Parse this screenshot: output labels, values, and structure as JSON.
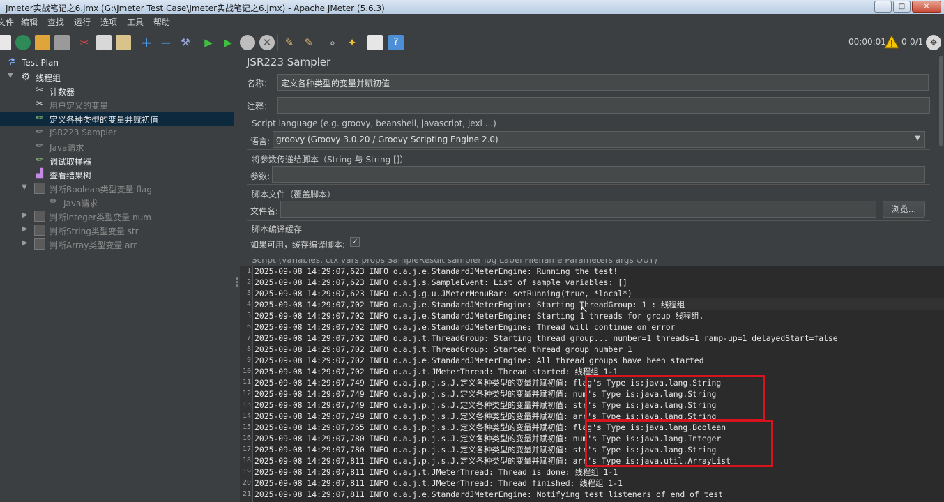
{
  "window": {
    "title": "Jmeter实战笔记之6.jmx (G:\\Jmeter Test Case\\Jmeter实战笔记之6.jmx) - Apache JMeter (5.6.3)",
    "min_label": "─",
    "max_label": "□",
    "close_label": "✕"
  },
  "menu": [
    "文件",
    "编辑",
    "查找",
    "运行",
    "选项",
    "工具",
    "帮助"
  ],
  "toolbar": {
    "timer": "00:00:01",
    "warnings": "0",
    "threads": "0/1"
  },
  "tree": {
    "items": [
      {
        "label": "Test Plan",
        "icon": "test-plan-icon"
      },
      {
        "label": "线程组",
        "icon": "gear-icon"
      },
      {
        "label": "计数器",
        "icon": "scissors-icon"
      },
      {
        "label": "用户定义的变量",
        "icon": "scissors-icon"
      },
      {
        "label": "定义各种类型的变量并赋初值",
        "icon": "pipette-icon"
      },
      {
        "label": "JSR223 Sampler",
        "icon": "pipette-icon"
      },
      {
        "label": "Java请求",
        "icon": "pipette-icon"
      },
      {
        "label": "调试取样器",
        "icon": "pipette-icon"
      },
      {
        "label": "查看结果树",
        "icon": "chart-icon"
      },
      {
        "label": "判断Boolean类型变量 flag",
        "icon": "controller-icon"
      },
      {
        "label": "Java请求",
        "icon": "pipette-icon"
      },
      {
        "label": "判断Integer类型变量 num",
        "icon": "controller-icon"
      },
      {
        "label": "判断String类型变量 str",
        "icon": "controller-icon"
      },
      {
        "label": "判断Array类型变量 arr",
        "icon": "controller-icon"
      }
    ]
  },
  "panel": {
    "title": "JSR223 Sampler",
    "name_label": "名称：",
    "name_value": "定义各种类型的变量并赋初值",
    "comment_label": "注释：",
    "comment_value": "",
    "script_language_group": "Script language (e.g. groovy, beanshell, javascript, jexl ...)",
    "language_label": "语言:",
    "language_value": "groovy     (Groovy 3.0.20 / Groovy Scripting Engine 2.0)",
    "params_group": "将参数传递给脚本（String 与 String []）",
    "params_label": "参数:",
    "params_value": "",
    "file_group": "脚本文件（覆盖脚本）",
    "filename_label": "文件名:",
    "filename_value": "",
    "browse_label": "浏览...",
    "cache_group": "脚本编译缓存",
    "cache_label": "如果可用，缓存编译脚本:",
    "cache_checked": "✓",
    "script_group_cut": "Script (variables: ctx vars props SampleResult sampler log Label Filename Parameters args OUT)"
  },
  "log": {
    "lines": [
      "2025-09-08 14:29:07,623 INFO o.a.j.e.StandardJMeterEngine: Running the test!",
      "2025-09-08 14:29:07,623 INFO o.a.j.s.SampleEvent: List of sample_variables: []",
      "2025-09-08 14:29:07,623 INFO o.a.j.g.u.JMeterMenuBar: setRunning(true, *local*)",
      "2025-09-08 14:29:07,702 INFO o.a.j.e.StandardJMeterEngine: Starting ThreadGroup: 1 : 线程组",
      "2025-09-08 14:29:07,702 INFO o.a.j.e.StandardJMeterEngine: Starting 1 threads for group 线程组.",
      "2025-09-08 14:29:07,702 INFO o.a.j.e.StandardJMeterEngine: Thread will continue on error",
      "2025-09-08 14:29:07,702 INFO o.a.j.t.ThreadGroup: Starting thread group... number=1 threads=1 ramp-up=1 delayedStart=false",
      "2025-09-08 14:29:07,702 INFO o.a.j.t.ThreadGroup: Started thread group number 1",
      "2025-09-08 14:29:07,702 INFO o.a.j.e.StandardJMeterEngine: All thread groups have been started",
      "2025-09-08 14:29:07,702 INFO o.a.j.t.JMeterThread: Thread started: 线程组 1-1",
      "2025-09-08 14:29:07,749 INFO o.a.j.p.j.s.J.定义各种类型的变量并赋初值: flag's Type is:java.lang.String",
      "2025-09-08 14:29:07,749 INFO o.a.j.p.j.s.J.定义各种类型的变量并赋初值: num's Type is:java.lang.String",
      "2025-09-08 14:29:07,749 INFO o.a.j.p.j.s.J.定义各种类型的变量并赋初值: str's Type is:java.lang.String",
      "2025-09-08 14:29:07,749 INFO o.a.j.p.j.s.J.定义各种类型的变量并赋初值: arr's Type is:java.lang.String",
      "2025-09-08 14:29:07,765 INFO o.a.j.p.j.s.J.定义各种类型的变量并赋初值: flag's Type is:java.lang.Boolean",
      "2025-09-08 14:29:07,780 INFO o.a.j.p.j.s.J.定义各种类型的变量并赋初值: num's Type is:java.lang.Integer",
      "2025-09-08 14:29:07,780 INFO o.a.j.p.j.s.J.定义各种类型的变量并赋初值: str's Type is:java.lang.String",
      "2025-09-08 14:29:07,811 INFO o.a.j.p.j.s.J.定义各种类型的变量并赋初值: arr's Type is:java.util.ArrayList",
      "2025-09-08 14:29:07,811 INFO o.a.j.t.JMeterThread: Thread is done: 线程组 1-1",
      "2025-09-08 14:29:07,811 INFO o.a.j.t.JMeterThread: Thread finished: 线程组 1-1",
      "2025-09-08 14:29:07,811 INFO o.a.j.e.StandardJMeterEngine: Notifying test listeners of end of test"
    ]
  },
  "colors": {
    "background": "#3c3f41",
    "editor_bg": "#2b2b2b",
    "selection": "#0d293e",
    "highlight_box": "#d7141e"
  }
}
